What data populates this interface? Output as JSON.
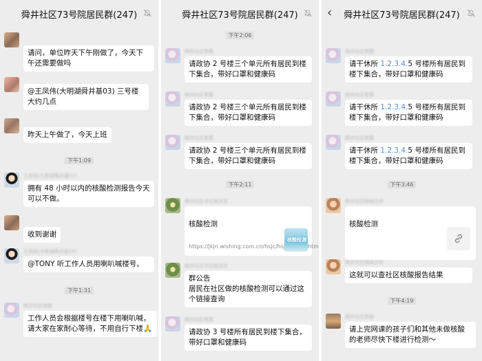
{
  "panels": [
    {
      "title": "舜井社区73号院居民群(247)"
    },
    {
      "title": "舜井社区73号院居民群(247)"
    },
    {
      "title": "舜井社区73号院居民群(247)"
    }
  ],
  "p1": {
    "m1": "请问，单位昨天下午刚做了，今天下午还需要做吗",
    "m2": "@王凤伟(大明湖舜井基03)  三号楼大约几点",
    "m3": "昨天上午做了，今天上班",
    "ts1": "下午1:09",
    "n4": "王凤伟(大明湖舜井基03)",
    "m4": "拥有 48 小时以内的核酸检测报告今天可以不做。",
    "m5": "收到谢谢",
    "n6": "王凤伟(大明湖舜井基03)",
    "m6": "@TONY  听工作人员用喇叭喊楼号。",
    "ts2": "下午1:31",
    "n7": "舜井社区党委",
    "m7": "工作人员会根据楼号在楼下用喇叭喊，请大家在家耐心等待，不用自行下楼🙏"
  },
  "p2": {
    "ts1": "下午2:06",
    "n1": "舜井社区党委",
    "m1": "请政协 2 号楼三个单元所有居民到楼下集合，带好口罩和健康码",
    "n2": "舜井社区党委",
    "m2": "请政协 2 号楼三个单元所有居民到楼下集合，带好口罩和健康码",
    "n3": "舜井社区党委",
    "m3": "请政协 2 号楼三个单元所有居民到楼下集合，带好口罩和健康码",
    "ts2": "下午2:11",
    "n4": "舜井社区书记张洪文",
    "card_title": "核酸检测",
    "card_url": "https://jkjn.wishing.com.cn/hsjc/hsjc_index.html",
    "card_thumb": "核酸检测",
    "n5": "舜井社区书记张洪文",
    "m5": "群公告\n居民在社区做的核酸检测可以通过这个链接查询",
    "n6": "舜井社区党委",
    "m6": "请政协 3 号楼所有居民到楼下集合，带好口罩和健康码"
  },
  "p3": {
    "n1": "舜井社区党委",
    "m1a": "请干休所 ",
    "m1n": "1.2.3.4.",
    "m1b": "5 号楼所有居民到楼下集合，带好口罩和健康码",
    "n2": "舜井社区党委",
    "m2a": "请干休所 ",
    "m2n": "1.2.3.4.",
    "m2b": "5 号楼所有居民到楼下集合，带好口罩和健康码",
    "n3": "舜井社区党委",
    "m3a": "请干休所 ",
    "m3n": "1.2.3.4.",
    "m3b": "5 号楼所有居民到楼下集合，带好口罩和健康码",
    "ts1": "下午3:46",
    "n4": "舜井社区网格员李",
    "card_title": "核酸检测",
    "n5": "舜井社区网格员李",
    "m5": "这就可以查社区核酸报告结果",
    "ts2": "下午4:19",
    "n6": "舜井社区党委",
    "m6": "请上完网课的孩子们和其他未做核酸的老师尽快下楼进行检测～"
  },
  "colors": {
    "bg": "#ededed",
    "bubble": "#ffffff",
    "link_number": "#5b8bd1"
  }
}
